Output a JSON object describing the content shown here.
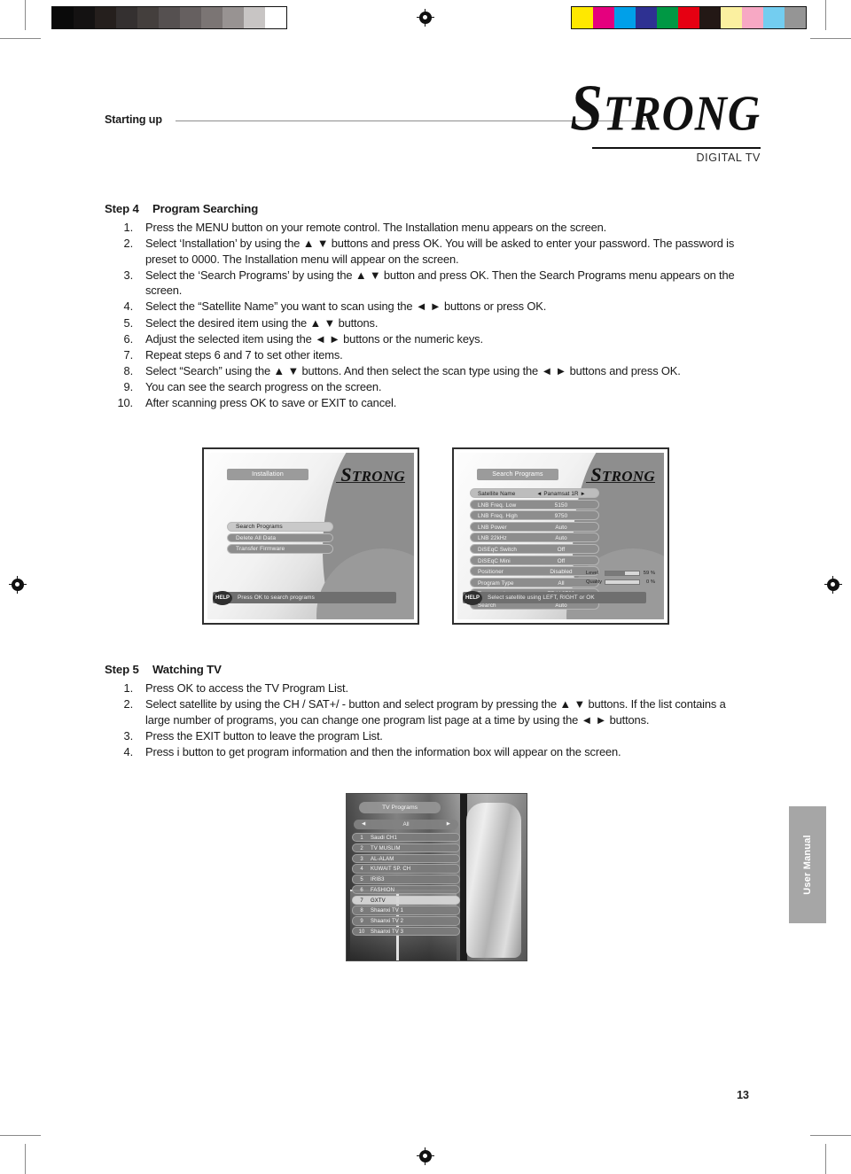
{
  "header": {
    "section_label": "Starting up",
    "logo_text": "STRONG",
    "logo_sub": "DIGITAL TV"
  },
  "step4": {
    "step_word": "Step 4",
    "title": "Program Searching",
    "items": [
      "Press the MENU button on your remote control. The Installation menu appears on the screen.",
      "Select ‘Installation’ by using the ▲ ▼ buttons and press OK. You will be asked to enter your password. The password is preset to 0000. The Installation menu will appear on the screen.",
      "Select the ‘Search Programs’ by using the ▲ ▼ button and press OK. Then the Search Programs menu appears on the screen.",
      "Select the “Satellite Name” you want to scan using the ◄ ► buttons or press OK.",
      "Select the desired item using the ▲ ▼ buttons.",
      "Adjust the selected item using the ◄ ► buttons or the numeric keys.",
      "Repeat steps 6 and 7 to set other items.",
      "Select “Search” using the ▲ ▼ buttons. And then select the scan type using the ◄ ► buttons and press OK.",
      "You can see the search progress on the screen.",
      "After scanning press OK to save or EXIT to cancel."
    ],
    "numbers": [
      "1.",
      "2.",
      "3.",
      "4.",
      "5.",
      "6.",
      "7.",
      "8.",
      "9.",
      "10."
    ]
  },
  "step5": {
    "step_word": "Step 5",
    "title": "Watching TV",
    "items": [
      "Press OK to access the TV Program List.",
      "Select satellite by using the CH / SAT+/ - button and select program by pressing the ▲ ▼ buttons. If the list contains a large number of programs, you can change one program list page at a time by using the ◄ ► buttons.",
      "Press the EXIT button to leave the program List.",
      "Press i button to get program information and then the information box will appear on the screen."
    ],
    "numbers": [
      "1.",
      "2.",
      "3.",
      "4."
    ]
  },
  "installation_screen": {
    "title": "Installation",
    "logo": "STRONG",
    "menu_items": [
      {
        "label": "Search Programs",
        "selected": true
      },
      {
        "label": "Delete All Data",
        "selected": false
      },
      {
        "label": "Transfer Firmware",
        "selected": false
      }
    ],
    "help_badge": "HELP",
    "help_text": "Press OK to search programs"
  },
  "search_programs_screen": {
    "title": "Search Programs",
    "logo": "STRONG",
    "rows": [
      {
        "label": "Satellite Name",
        "value": "◄ Panamsat 1R ►",
        "selected": true
      },
      {
        "label": "LNB Freq. Low",
        "value": "5150",
        "selected": false
      },
      {
        "label": "LNB Freq. High",
        "value": "9750",
        "selected": false
      },
      {
        "label": "LNB Power",
        "value": "Auto",
        "selected": false
      },
      {
        "label": "LNB 22kHz",
        "value": "Auto",
        "selected": false
      },
      {
        "label": "DiSEqC Switch",
        "value": "Off",
        "selected": false
      },
      {
        "label": "DiSEqC Mini",
        "value": "Off",
        "selected": false
      },
      {
        "label": "Positioner",
        "value": "Disabled",
        "selected": false
      },
      {
        "label": "Program Type",
        "value": "All",
        "selected": false
      },
      {
        "label": "Transponder",
        "value": "TP V 3760",
        "selected": false
      },
      {
        "label": "Search",
        "value": "Auto",
        "selected": false
      }
    ],
    "meters": [
      {
        "name": "Level",
        "percent": "59 %",
        "fill": 59
      },
      {
        "name": "Quality",
        "percent": "0 %",
        "fill": 0
      }
    ],
    "help_badge": "HELP",
    "help_text": "Select satellite using LEFT, RIGHT or OK"
  },
  "program_list_screen": {
    "title": "TV Programs",
    "group": "All",
    "rows": [
      {
        "num": "1",
        "name": "Saudi CH1",
        "selected": false
      },
      {
        "num": "2",
        "name": "TV MUSLIM",
        "selected": false
      },
      {
        "num": "3",
        "name": "AL-ALAM",
        "selected": false
      },
      {
        "num": "4",
        "name": "KUWAIT SP. CH",
        "selected": false
      },
      {
        "num": "5",
        "name": "IRIB3",
        "selected": false
      },
      {
        "num": "6",
        "name": "FASHION",
        "selected": false
      },
      {
        "num": "7",
        "name": "GXTV",
        "selected": true
      },
      {
        "num": "8",
        "name": "Shaanxi TV 1",
        "selected": false
      },
      {
        "num": "9",
        "name": "Shaanxi TV 2",
        "selected": false
      },
      {
        "num": "10",
        "name": "Shaanxi TV 3",
        "selected": false
      }
    ]
  },
  "side_tab": {
    "label": "User Manual"
  },
  "page_number": "13",
  "calibration": {
    "grayscale": [
      "#0a0a0a",
      "#141212",
      "#251f1d",
      "#343030",
      "#443f3d",
      "#555050",
      "#666060",
      "#7b7574",
      "#989392",
      "#c8c5c4",
      "#ffffff"
    ],
    "colors": [
      "#ffe800",
      "#e5007e",
      "#00a0e9",
      "#2e3192",
      "#009844",
      "#e60012",
      "#231815",
      "#fbf0a0",
      "#f7a8c4",
      "#73cdf0",
      "#959595"
    ]
  }
}
